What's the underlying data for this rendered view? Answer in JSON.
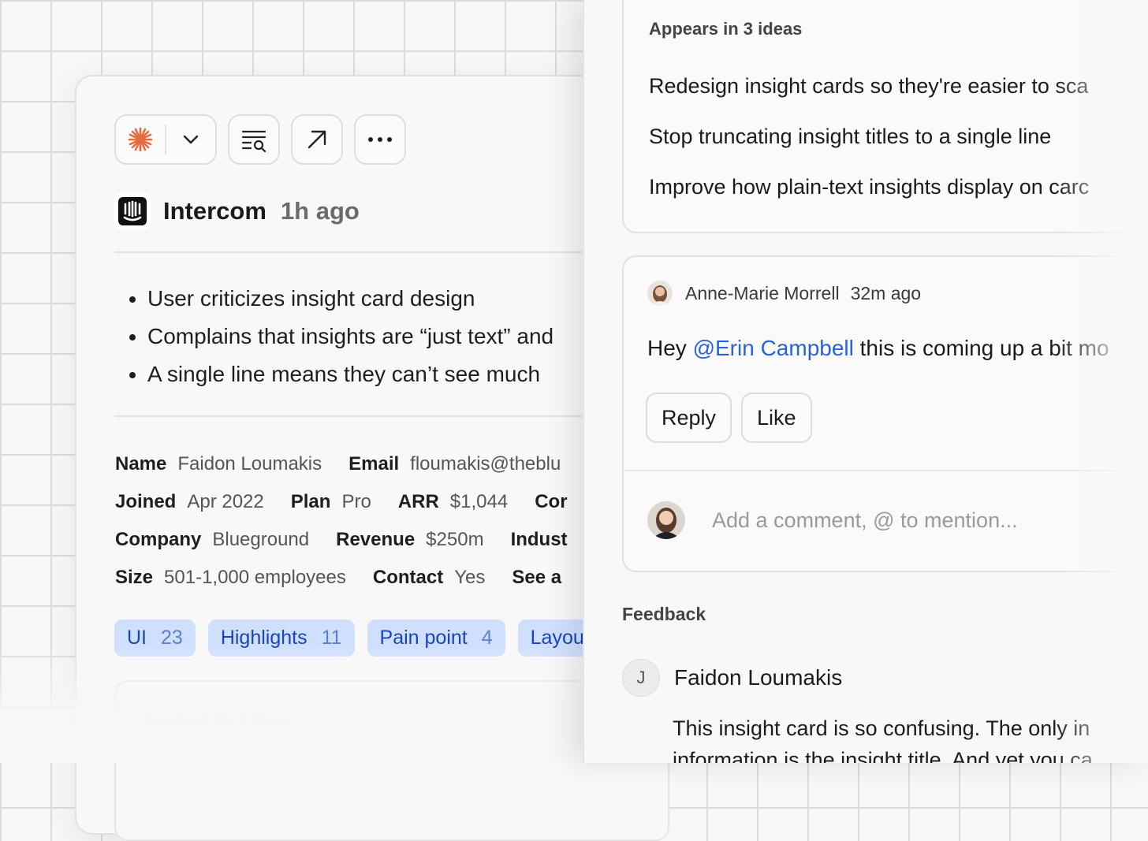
{
  "insight": {
    "source": {
      "name": "Intercom",
      "time": "1h ago"
    },
    "bullets": [
      "User criticizes insight card design",
      "Complains that insights are “just text” and",
      "A single line means they can’t see much"
    ],
    "meta": {
      "row1": [
        {
          "k": "Name",
          "v": "Faidon Loumakis"
        },
        {
          "k": "Email",
          "v": "floumakis@theblu"
        }
      ],
      "row2": [
        {
          "k": "Joined",
          "v": "Apr 2022"
        },
        {
          "k": "Plan",
          "v": "Pro"
        },
        {
          "k": "ARR",
          "v": "$1,044"
        },
        {
          "k": "Cor",
          "v": ""
        }
      ],
      "row3": [
        {
          "k": "Company",
          "v": "Blueground"
        },
        {
          "k": "Revenue",
          "v": "$250m"
        },
        {
          "k": "Indust",
          "v": ""
        }
      ],
      "row4": [
        {
          "k": "Size",
          "v": "501-1,000 employees"
        },
        {
          "k": "Contact",
          "v": "Yes"
        },
        {
          "k": "See a",
          "v": ""
        }
      ]
    },
    "tags": [
      {
        "label": "UI",
        "count": "23"
      },
      {
        "label": "Highlights",
        "count": "11"
      },
      {
        "label": "Pain point",
        "count": "4"
      },
      {
        "label": "Layou",
        "count": ""
      }
    ],
    "ghost_title": "Appears in 3 ideas"
  },
  "ideas": {
    "title": "Appears in 3 ideas",
    "items": [
      "Redesign insight cards so they're easier to sca",
      "Stop truncating insight titles to a single line",
      "Improve how plain-text insights display on carc"
    ]
  },
  "comment": {
    "author": "Anne-Marie Morrell",
    "time": "32m ago",
    "body_prefix": "Hey ",
    "mention": "@Erin Campbell",
    "body_suffix": " this is coming up a bit mo",
    "reply_label": "Reply",
    "like_label": "Like",
    "add_placeholder": "Add a comment, @ to mention..."
  },
  "feedback": {
    "label": "Feedback",
    "avatar_initial": "J",
    "author": "Faidon Loumakis",
    "body": "This insight card is so confusing. The only in",
    "body_line2": "information is the insight title. And yet you ca"
  },
  "colors": {
    "accent_orange": "#e46b3f",
    "tag_bg": "#cfe0ff",
    "tag_text": "#1a45b8",
    "mention": "#2a63d8"
  }
}
